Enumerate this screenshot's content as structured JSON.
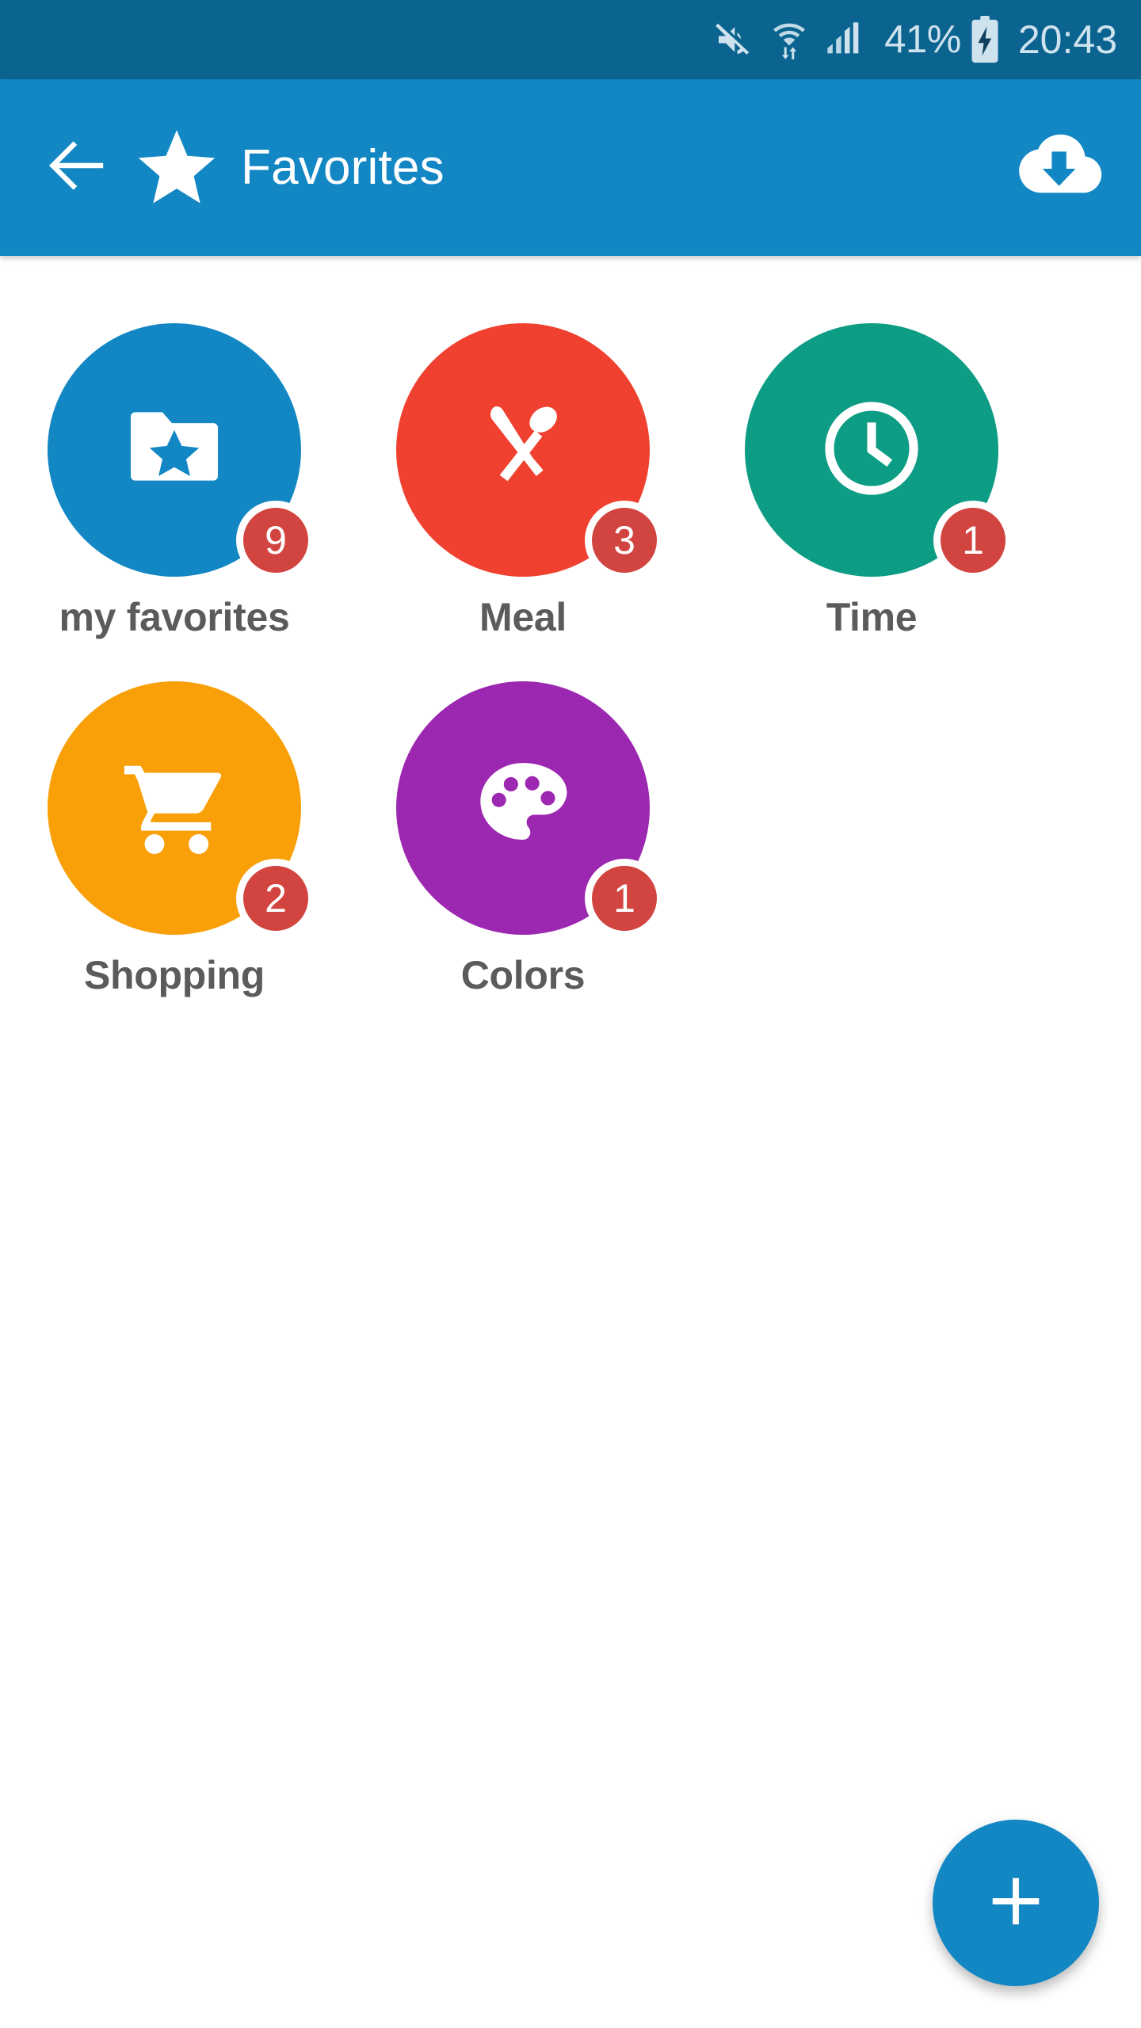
{
  "status_bar": {
    "mute_icon": "mute-icon",
    "wifi_icon": "wifi-icon",
    "signal_icon": "signal-bars-icon",
    "battery_percent": "41%",
    "battery_icon": "battery-charging-icon",
    "clock": "20:43"
  },
  "app_bar": {
    "back_icon": "back-arrow-icon",
    "star_icon": "star-icon",
    "title": "Favorites",
    "action_icon": "cloud-download-icon"
  },
  "grid": {
    "items": [
      {
        "label": "my favorites",
        "badge": "9",
        "color": "#1287c4",
        "icon": "folder-star-icon"
      },
      {
        "label": "Meal",
        "badge": "3",
        "color": "#f0402f",
        "icon": "cutlery-icon"
      },
      {
        "label": "Time",
        "badge": "1",
        "color": "#0d9c84",
        "icon": "clock-icon"
      },
      {
        "label": "Shopping",
        "badge": "2",
        "color": "#f99f07",
        "icon": "shopping-cart-icon"
      },
      {
        "label": "Colors",
        "badge": "1",
        "color": "#9c27b0",
        "icon": "palette-icon"
      }
    ]
  },
  "fab": {
    "icon": "plus-icon",
    "label": "+"
  },
  "colors": {
    "status_bar": "#0b6490",
    "app_bar": "#1287c4",
    "badge": "#d2443f",
    "label_text": "#5b5b5b",
    "background": "#ffffff"
  }
}
